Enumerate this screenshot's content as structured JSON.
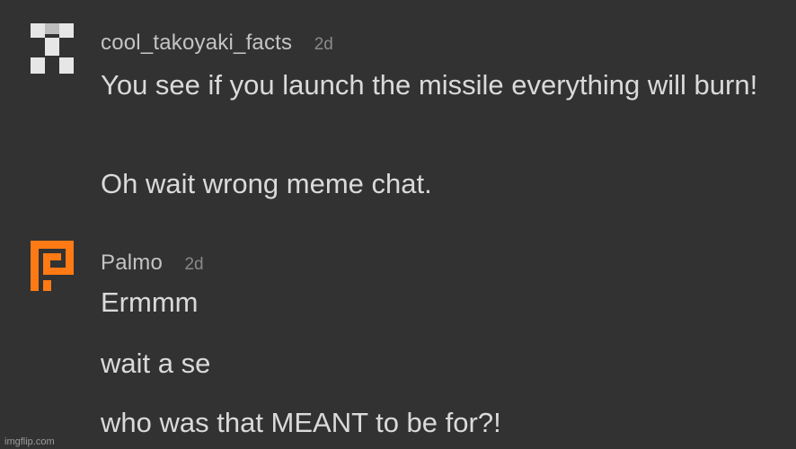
{
  "comments": [
    {
      "username": "cool_takoyaki_facts",
      "time": "2d",
      "avatar_icon": "pixel-white-avatar-icon",
      "avatar_color": "#e6e6e6",
      "paragraphs": [
        "You see if you launch the missile everything will burn!",
        "Oh wait wrong meme chat."
      ]
    },
    {
      "username": "Palmo",
      "time": "2d",
      "avatar_icon": "pixel-orange-p-avatar-icon",
      "avatar_color": "#ff7a14",
      "paragraphs": [
        "Ermmm",
        "wait a se",
        "who was that MEANT to be for?!"
      ]
    }
  ],
  "watermark": "imgflip.com"
}
